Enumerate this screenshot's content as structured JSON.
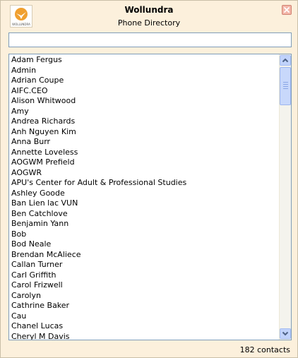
{
  "app": {
    "title": "Wollundra",
    "subtitle": "Phone Directory",
    "logo_text": "WOLLUNDRA"
  },
  "search": {
    "value": "",
    "placeholder": ""
  },
  "contacts": [
    "Adam Fergus",
    "Admin",
    "Adrian Coupe",
    "AIFC.CEO",
    "Alison Whitwood",
    "Amy",
    "Andrea Richards",
    "Anh Nguyen Kim",
    "Anna Burr",
    "Annette Loveless",
    "AOGWM Prefield",
    "AOGWR",
    "APU's Center for Adult & Professional Studies",
    "Ashley Goode",
    "Ban Lien lac VUN",
    "Ben Catchlove",
    "Benjamin Yann",
    "Bob",
    "Bod Neale",
    "Brendan McAliece",
    "Callan Turner",
    "Carl Griffith",
    "Carol Frizwell",
    "Carolyn",
    "Cathrine Baker",
    "Cau",
    "Chanel Lucas",
    "Cheryl M Davis"
  ],
  "status": {
    "count_text": "182 contacts"
  },
  "icons": {
    "logo": "bird-logo-icon",
    "close": "close-icon",
    "scroll_up": "chevron-up-icon",
    "scroll_down": "chevron-down-icon"
  },
  "colors": {
    "window_bg": "#fcf0dc",
    "close_bg": "#f3b6a9",
    "scrollbar_btn": "#c1d3fb",
    "logo_accent": "#f0a030"
  }
}
